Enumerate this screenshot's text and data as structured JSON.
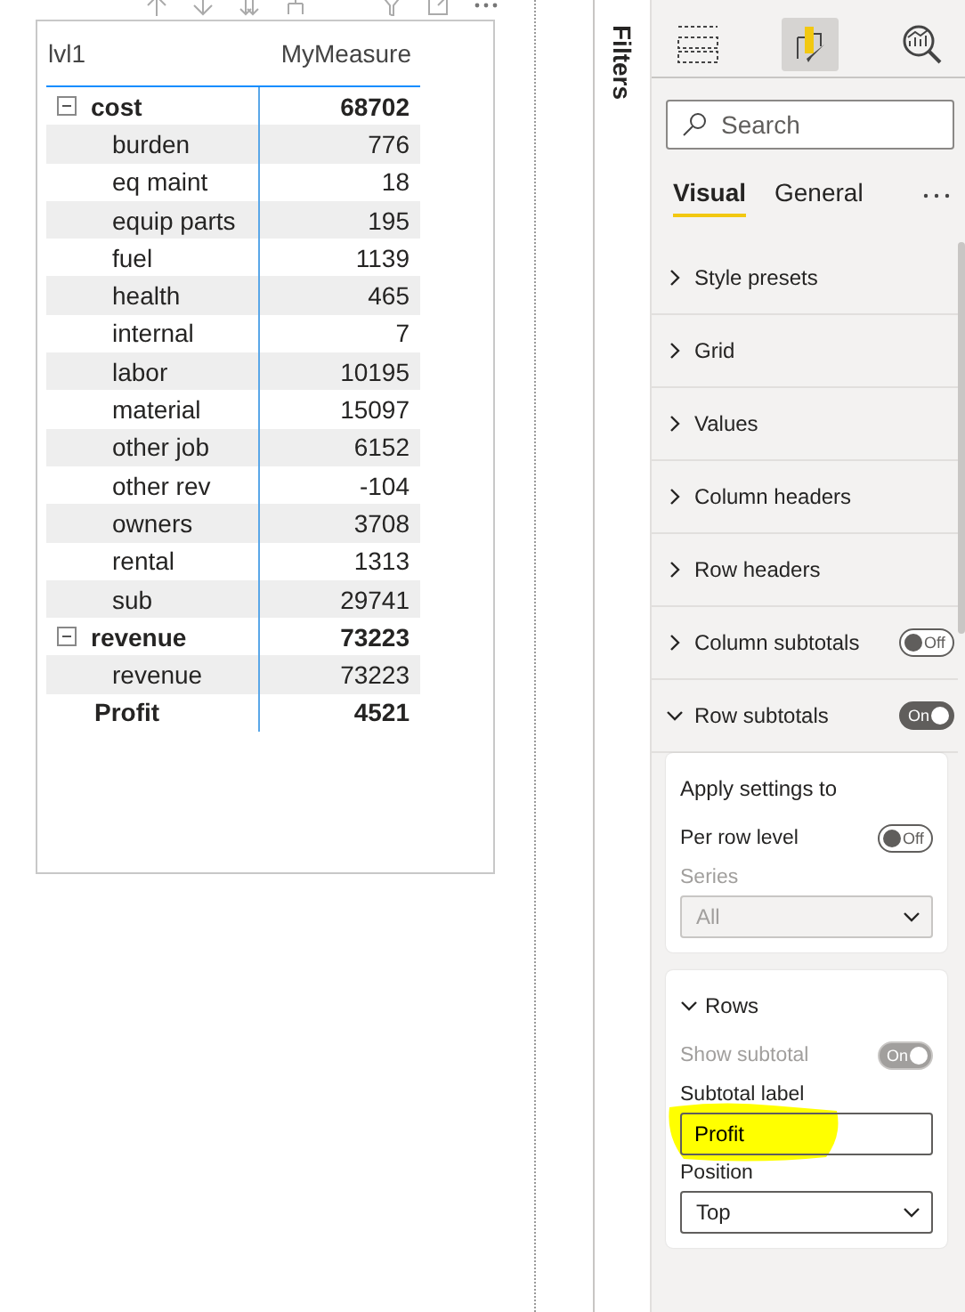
{
  "table": {
    "columns": [
      "lvl1",
      "MyMeasure"
    ],
    "rows": [
      {
        "label": "cost",
        "value": "68702",
        "kind": "group",
        "expanded": true,
        "children": [
          {
            "label": "burden",
            "value": "776"
          },
          {
            "label": "eq maint",
            "value": "18"
          },
          {
            "label": "equip parts",
            "value": "195"
          },
          {
            "label": "fuel",
            "value": "1139"
          },
          {
            "label": "health",
            "value": "465"
          },
          {
            "label": "internal",
            "value": "7"
          },
          {
            "label": "labor",
            "value": "10195"
          },
          {
            "label": "material",
            "value": "15097"
          },
          {
            "label": "other job",
            "value": "6152"
          },
          {
            "label": "other rev",
            "value": "-104"
          },
          {
            "label": "owners",
            "value": "3708"
          },
          {
            "label": "rental",
            "value": "1313"
          },
          {
            "label": "sub",
            "value": "29741"
          }
        ]
      },
      {
        "label": "revenue",
        "value": "73223",
        "kind": "group",
        "expanded": true,
        "children": [
          {
            "label": "revenue",
            "value": "73223"
          }
        ]
      },
      {
        "label": "Profit",
        "value": "4521",
        "kind": "total"
      }
    ]
  },
  "filters_pane": {
    "label": "Filters"
  },
  "format_pane": {
    "pane_buttons": [
      {
        "kind": "fields",
        "selected": false
      },
      {
        "kind": "format",
        "selected": true
      },
      {
        "kind": "analytics",
        "selected": false
      }
    ],
    "search": {
      "placeholder": "Search"
    },
    "tabs": [
      {
        "label": "Visual",
        "selected": true
      },
      {
        "label": "General",
        "selected": false
      }
    ],
    "sections": [
      {
        "label": "Style presets",
        "expanded": false
      },
      {
        "label": "Grid",
        "expanded": false
      },
      {
        "label": "Values",
        "expanded": false
      },
      {
        "label": "Column headers",
        "expanded": false
      },
      {
        "label": "Row headers",
        "expanded": false
      },
      {
        "label": "Column subtotals",
        "expanded": false,
        "toggle": {
          "on": false,
          "label": "Off"
        }
      },
      {
        "label": "Row subtotals",
        "expanded": true,
        "toggle": {
          "on": true,
          "label": "On"
        }
      }
    ],
    "cards": [
      {
        "title": "Apply settings to",
        "items": [
          {
            "kind": "toggle",
            "label": "Per row level",
            "on": false,
            "toggle_label": "Off",
            "disabled": false
          },
          {
            "kind": "select",
            "label": "Series",
            "value": "All",
            "disabled": true
          }
        ]
      },
      {
        "title": "Rows",
        "expanded": true,
        "items": [
          {
            "kind": "toggle",
            "label": "Show subtotal",
            "on": true,
            "toggle_label": "On",
            "disabled": true
          },
          {
            "kind": "text",
            "label": "Subtotal label",
            "value": "Profit",
            "highlighted": true
          },
          {
            "kind": "select",
            "label": "Position",
            "value": "Top",
            "disabled": false
          }
        ]
      }
    ]
  }
}
